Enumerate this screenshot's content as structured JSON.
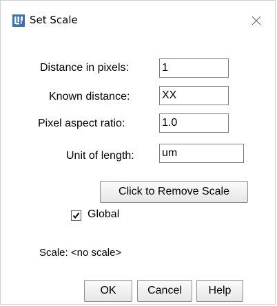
{
  "window": {
    "title": "Set Scale"
  },
  "fields": {
    "distance_in_pixels": {
      "label": "Distance in pixels:",
      "value": "1"
    },
    "known_distance": {
      "label": "Known distance:",
      "value": "XX"
    },
    "pixel_aspect_ratio": {
      "label": "Pixel aspect ratio:",
      "value": "1.0"
    },
    "unit_of_length": {
      "label": "Unit of length:",
      "value": "um"
    }
  },
  "remove_scale_button": {
    "label": "Click to Remove Scale"
  },
  "global": {
    "label": "Global",
    "checked": true
  },
  "scale_line": {
    "text": "Scale: <no scale>"
  },
  "buttons": {
    "ok": "OK",
    "cancel": "Cancel",
    "help": "Help"
  },
  "icons": {
    "app": "imagej-app-icon",
    "close": "close-icon",
    "check": "checkmark-icon"
  },
  "colors": {
    "app_icon": "#3b6fb6"
  }
}
